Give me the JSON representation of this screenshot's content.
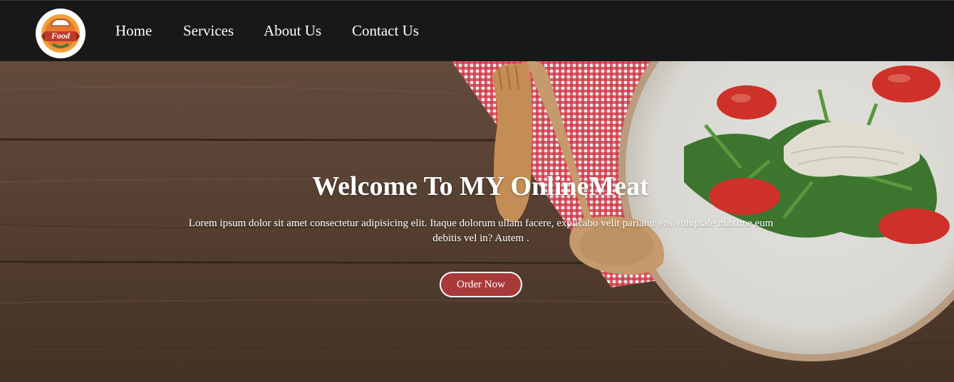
{
  "nav": {
    "logo_text": "Food",
    "links": [
      {
        "label": "Home"
      },
      {
        "label": "Services"
      },
      {
        "label": "About Us"
      },
      {
        "label": "Contact Us"
      }
    ]
  },
  "hero": {
    "title": "Welcome To MY OnlineMeat",
    "description": "Lorem ipsum dolor sit amet consectetur adipisicing elit. Itaque dolorum ullam facere, explicabo velit pariatur eos voluptate maxime eum debitis vel in? Autem .",
    "button_label": "Order Now"
  },
  "colors": {
    "navbar": "#181818",
    "accent_button": "#a83a3a",
    "wood": "#5c4434",
    "checkered_cloth": "#d9203a"
  }
}
